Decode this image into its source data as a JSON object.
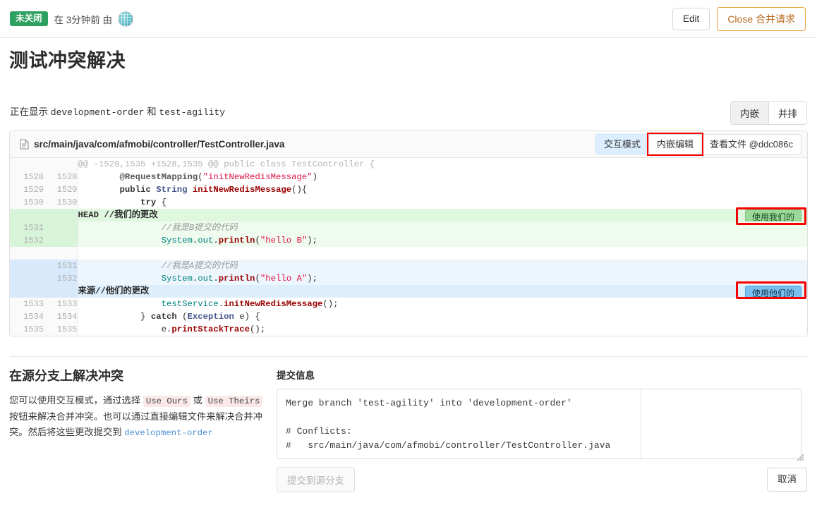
{
  "status": {
    "badge": "未关闭",
    "meta": "在 3分钟前 由",
    "avatar_icon": "globe-avatar",
    "edit_label": "Edit",
    "close_label": "Close 合并请求"
  },
  "title": "测试冲突解决",
  "compare": {
    "prefix": "正在显示",
    "source_branch": "development-order",
    "conjunction": "和",
    "target_branch": "test-agility"
  },
  "view_toggle": {
    "inline": "内嵌",
    "side_by_side": "并排"
  },
  "file": {
    "icon": "file-document-icon",
    "path": "src/main/java/com/afmobi/controller/TestController.java",
    "actions": {
      "interactive_mode": "交互模式",
      "inline_edit": "内嵌编辑",
      "view_file": "查看文件 @ddc086c"
    }
  },
  "diff": {
    "hunk_header": "@@ -1528,1535 +1528,1535 @@ public class TestController {",
    "ours_button": "使用我们的",
    "theirs_button": "使用他们的",
    "head_marker": "HEAD //我们的更改",
    "origin_marker": "来源//他们的更改",
    "rows": [
      {
        "type": "hunk",
        "old": "",
        "new": "",
        "code": "@@ -1528,1535 +1528,1535 @@ public class TestController {"
      },
      {
        "type": "ctx",
        "old": "1528",
        "new": "1528",
        "code": "        @RequestMapping(\"initNewRedisMessage\")"
      },
      {
        "type": "ctx",
        "old": "1529",
        "new": "1529",
        "code": "        public String initNewRedisMessage(){"
      },
      {
        "type": "ctx",
        "old": "1530",
        "new": "1530",
        "code": "            try {"
      },
      {
        "type": "addhdr",
        "old": "",
        "new": "",
        "code": "HEAD //我们的更改"
      },
      {
        "type": "add",
        "old": "1531",
        "new": "",
        "code": "                //我是B提交的代码"
      },
      {
        "type": "add",
        "old": "1532",
        "new": "",
        "code": "                System.out.println(\"hello B\");"
      },
      {
        "type": "blank",
        "old": "",
        "new": "",
        "code": ""
      },
      {
        "type": "del",
        "old": "",
        "new": "1531",
        "code": "                //我是A提交的代码"
      },
      {
        "type": "del",
        "old": "",
        "new": "1532",
        "code": "                System.out.println(\"hello A\");"
      },
      {
        "type": "delhdr",
        "old": "",
        "new": "",
        "code": "来源//他们的更改"
      },
      {
        "type": "ctx",
        "old": "1533",
        "new": "1533",
        "code": "                testService.initNewRedisMessage();"
      },
      {
        "type": "ctx",
        "old": "1534",
        "new": "1534",
        "code": "            } catch (Exception e) {"
      },
      {
        "type": "ctx",
        "old": "1535",
        "new": "1535",
        "code": "                e.printStackTrace();"
      }
    ]
  },
  "resolve_section": {
    "heading": "在源分支上解决冲突",
    "body_1": "您可以使用交互模式，通过选择",
    "code_ours": "Use Ours",
    "body_2": "或",
    "code_theirs": "Use Theirs",
    "body_3": "按钮来解决合并冲突。也可以通过直接编辑文件来解决合并冲突。然后将这些更改提交到",
    "branch": "development-order"
  },
  "commit": {
    "label": "提交信息",
    "message": "Merge branch 'test-agility' into 'development-order'\n\n# Conflicts:\n#   src/main/java/com/afmobi/controller/TestController.java",
    "submit_label": "提交到源分支",
    "cancel_label": "取消"
  },
  "colors": {
    "badge_green": "#2da160",
    "close_orange": "#e9a13b",
    "add_bg": "#eefbee",
    "del_bg": "#eef6fd",
    "ours_btn": "#9bd99b",
    "theirs_btn": "#7cc0f0",
    "annotation_red": "#f70000",
    "link_blue": "#4a8fd4"
  }
}
